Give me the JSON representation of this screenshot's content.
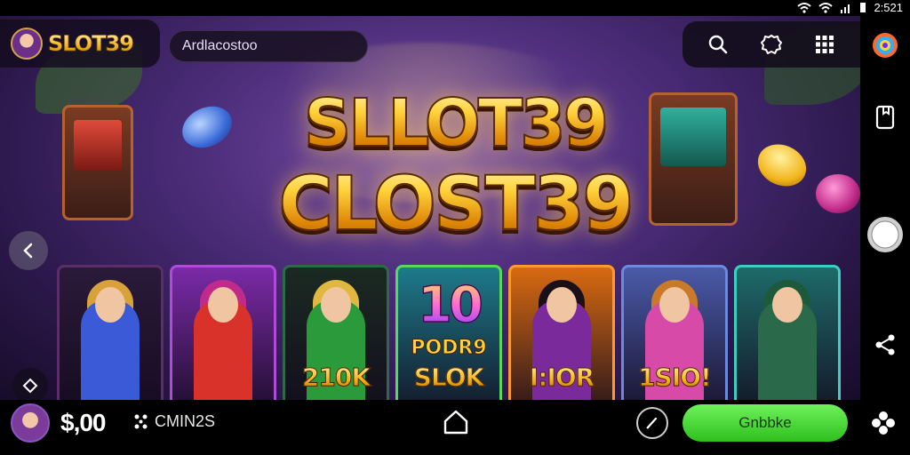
{
  "status": {
    "time": "2:521"
  },
  "header": {
    "brand": "SLOT39",
    "search_text": "Ardlacostoo"
  },
  "title": {
    "line1": "SLLOT39",
    "line2": "CLOST39"
  },
  "cards": [
    {
      "label": "",
      "theme": "#2a1a3a",
      "border": "#5b2e6a"
    },
    {
      "label": "",
      "theme": "#7b2aa8",
      "border": "#b04ad8"
    },
    {
      "label": "210K",
      "theme": "#1b2a22",
      "border": "#2f6a48"
    },
    {
      "big": "10",
      "mid": "PODR9",
      "label": "SLOK",
      "theme": "#1d7a8a",
      "border": "#5ad85a"
    },
    {
      "label": "I:IOR",
      "theme": "#d86a12",
      "border": "#ff9a2a"
    },
    {
      "label": "1SIO!",
      "theme": "#4a5aa8",
      "border": "#6a8ae0"
    },
    {
      "label": "",
      "theme": "#1e6a6a",
      "border": "#3ad0c0"
    }
  ],
  "bottom": {
    "balance": "$,00",
    "coins_label": "CMIN2S",
    "primary_button": "Gnbbke"
  },
  "colors": {
    "accent_green": "#3fd42a",
    "gold": "#f2b51c"
  }
}
